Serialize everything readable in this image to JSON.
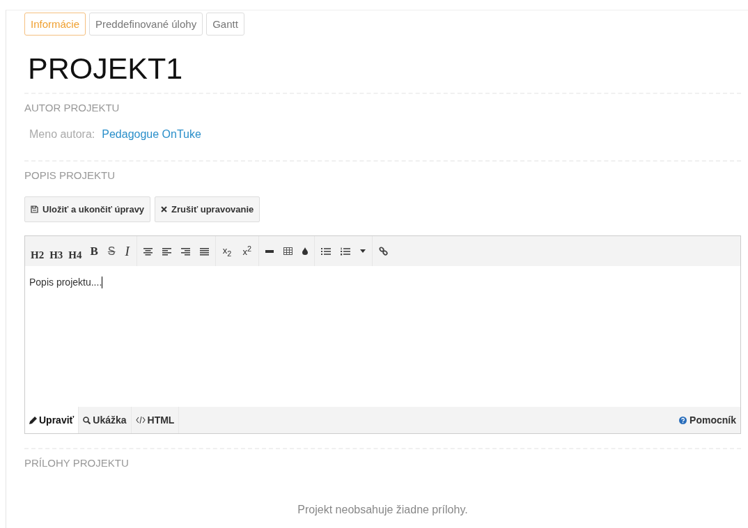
{
  "tabs": [
    {
      "label": "Informácie",
      "selected": true
    },
    {
      "label": "Preddefinované úlohy",
      "selected": false
    },
    {
      "label": "Gantt",
      "selected": false
    }
  ],
  "title": "PROJEKT1",
  "author_section": {
    "heading": "AUTOR PROJEKTU",
    "label": "Meno autora:",
    "name": "Pedagogue OnTuke"
  },
  "description_section": {
    "heading": "POPIS PROJEKTU",
    "buttons": [
      {
        "label": "Uložiť a ukončiť úpravy",
        "kind": "save"
      },
      {
        "label": "Zrušiť upravovanie",
        "kind": "cancel"
      }
    ],
    "editor": {
      "format_buttons": [
        {
          "label": "H2",
          "kind": "heading"
        },
        {
          "label": "H3",
          "kind": "heading"
        },
        {
          "label": "H4",
          "kind": "heading"
        },
        {
          "label": "B",
          "kind": "bold"
        },
        {
          "label": "S",
          "kind": "strike"
        },
        {
          "label": "I",
          "kind": "italic"
        }
      ],
      "script_buttons": [
        "x$_{2}$",
        "x$^{2}$"
      ],
      "content": "Popis projektu....",
      "modes": [
        {
          "label": "Upraviť",
          "kind": "edit",
          "selected": true
        },
        {
          "label": "Ukážka",
          "kind": "preview",
          "selected": false
        },
        {
          "label": "HTML",
          "kind": "html",
          "selected": false
        }
      ],
      "help": "Pomocník"
    }
  },
  "attachments_section": {
    "heading": "PRÍLOHY PROJEKTU",
    "empty_text": "Projekt neobsahuje žiadne prílohy."
  }
}
